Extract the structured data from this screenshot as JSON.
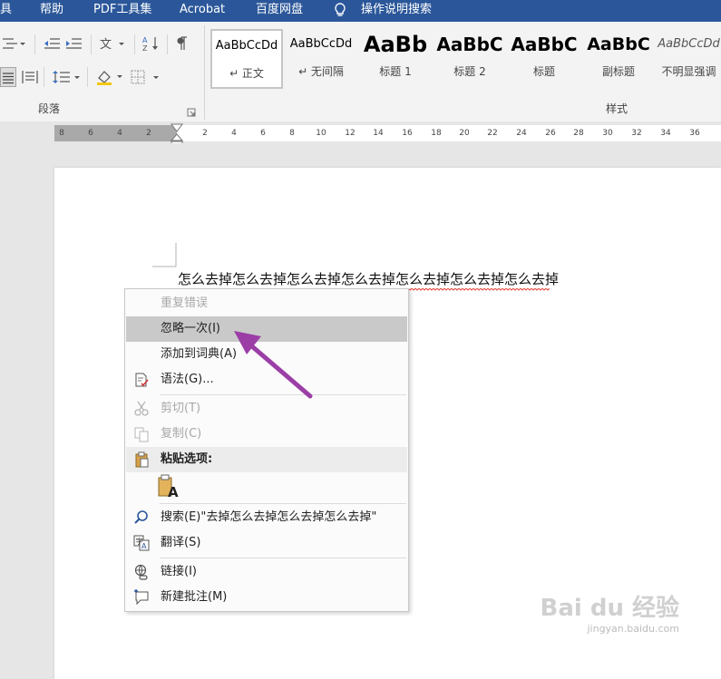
{
  "menubar": {
    "items": [
      "具",
      "帮助",
      "PDF工具集",
      "Acrobat",
      "百度网盘",
      "操作说明搜索"
    ]
  },
  "ribbon": {
    "paragraph_group_label": "段落",
    "styles_group_label": "样式",
    "styles": [
      {
        "sample": "AaBbCcDd",
        "name": "↵ 正文"
      },
      {
        "sample": "AaBbCcDd",
        "name": "↵ 无间隔"
      },
      {
        "sample": "AaBb",
        "name": "标题 1"
      },
      {
        "sample": "AaBbC",
        "name": "标题 2"
      },
      {
        "sample": "AaBbC",
        "name": "标题"
      },
      {
        "sample": "AaBbC",
        "name": "副标题"
      },
      {
        "sample": "AaBbCcDd",
        "name": "不明显强调"
      }
    ]
  },
  "ruler": {
    "left_ticks": [
      "8",
      "6",
      "4",
      "2"
    ],
    "right_ticks": [
      "2",
      "4",
      "6",
      "8",
      "10",
      "12",
      "14",
      "16",
      "18",
      "20",
      "22",
      "24",
      "26",
      "28",
      "30",
      "32",
      "34",
      "36"
    ]
  },
  "document": {
    "text": "怎么去掉怎么去掉怎么去掉怎么去掉怎么去掉怎么去掉怎么去掉"
  },
  "context_menu": {
    "items": [
      {
        "label": "重复错误",
        "state": "disabled",
        "icon": ""
      },
      {
        "label": "忽略一次(I)",
        "state": "highlighted",
        "icon": ""
      },
      {
        "label": "添加到词典(A)",
        "state": "normal",
        "icon": ""
      },
      {
        "label": "语法(G)...",
        "state": "normal",
        "icon": "grammar-icon"
      },
      {
        "label": "剪切(T)",
        "state": "disabled",
        "icon": "scissors-icon"
      },
      {
        "label": "复制(C)",
        "state": "disabled",
        "icon": "copy-icon"
      },
      {
        "label": "粘贴选项:",
        "state": "section",
        "icon": "clipboard-icon"
      },
      {
        "label": "搜索(E)\"去掉怎么去掉怎么去掉怎么去掉\"",
        "state": "normal",
        "icon": "search-icon"
      },
      {
        "label": "翻译(S)",
        "state": "normal",
        "icon": "translate-icon"
      },
      {
        "label": "链接(I)",
        "state": "normal",
        "icon": "link-icon"
      },
      {
        "label": "新建批注(M)",
        "state": "normal",
        "icon": "comment-icon"
      }
    ],
    "paste_option_glyph": "A"
  },
  "watermark": {
    "brand": "Bai du 经验",
    "url": "jingyan.baidu.com"
  },
  "colors": {
    "menubar": "#2b579a",
    "highlight": "#c9c9c9",
    "arrow": "#9b3fa6",
    "squiggle": "#e0453a"
  }
}
